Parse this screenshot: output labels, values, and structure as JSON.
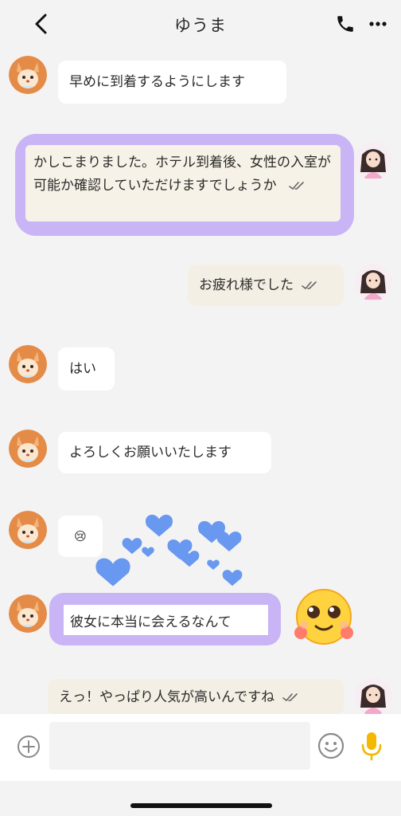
{
  "header": {
    "title": "ゆうま",
    "back_icon": "chevron-left-icon",
    "call_icon": "phone-icon",
    "more_icon": "more-horizontal-icon"
  },
  "messages": [
    {
      "side": "in",
      "text": "早めに到着するようにします"
    },
    {
      "side": "out",
      "text": "かしこまりました。ホテル到着後、女性の入室が可能か確認していただけますでしょうか",
      "read": true,
      "highlighted": true
    },
    {
      "side": "out",
      "text": "お疲れ様でした",
      "read": true
    },
    {
      "side": "in",
      "text": "はい"
    },
    {
      "side": "in",
      "text": "よろしくお願いいたします"
    },
    {
      "side": "in",
      "text": "😢"
    },
    {
      "side": "in",
      "text": "彼女に本当に会えるなんて",
      "highlighted": true
    },
    {
      "side": "out",
      "text": "えっ！やっぱり人気が高いんですね",
      "read": true
    }
  ],
  "composer": {
    "placeholder": "",
    "plus_icon": "plus-circle-icon",
    "emoji_icon": "smiley-icon",
    "mic_icon": "microphone-icon"
  },
  "colors": {
    "background": "#f4f3f3",
    "incoming_bubble": "#ffffff",
    "outgoing_bubble": "#f4efe4",
    "highlight_ring": "#c9b4f6",
    "mic": "#f5b800",
    "hearts": "#5b8ff0"
  }
}
